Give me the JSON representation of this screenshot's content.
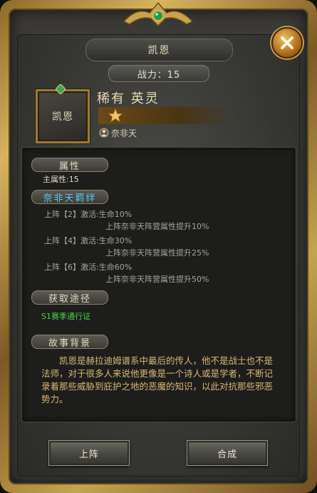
{
  "header": {
    "title": "凯恩",
    "close_icon": "close-icon"
  },
  "hero": {
    "power_label": "战力：15",
    "avatar_name": "凯恩",
    "rarity_label": "稀有 英灵",
    "stars": 1,
    "faction": "奈非天"
  },
  "sections": {
    "attributes": {
      "title": "属性",
      "main_attr": "主属性:15"
    },
    "bond": {
      "title": "奈非天羁绊",
      "entries": [
        {
          "condition": "上阵【2】激活:生命10%",
          "effect": "上阵奈非天阵营属性提升10%"
        },
        {
          "condition": "上阵【4】激活:生命30%",
          "effect": "上阵奈非天阵营属性提升25%"
        },
        {
          "condition": "上阵【6】激活:生命60%",
          "effect": "上阵奈非天阵营属性提升50%"
        }
      ]
    },
    "source": {
      "title": "获取途径",
      "value": "S1赛季通行证"
    },
    "story": {
      "title": "故事背景",
      "text": "凯恩是赫拉迪姆谱系中最后的传人，他不是战士也不是法师，对于很多人来说他更像是一个诗人或是学者，不断记录着那些威胁到庇护之地的恶魔的知识，以此对抗那些邪恶势力。"
    }
  },
  "actions": {
    "deploy_label": "上阵",
    "compose_label": "合成"
  },
  "colors": {
    "gold": "#c9a24d",
    "cyan_title": "#58c8ee",
    "green_text": "#4ed24e",
    "story_text": "#d8b878"
  }
}
